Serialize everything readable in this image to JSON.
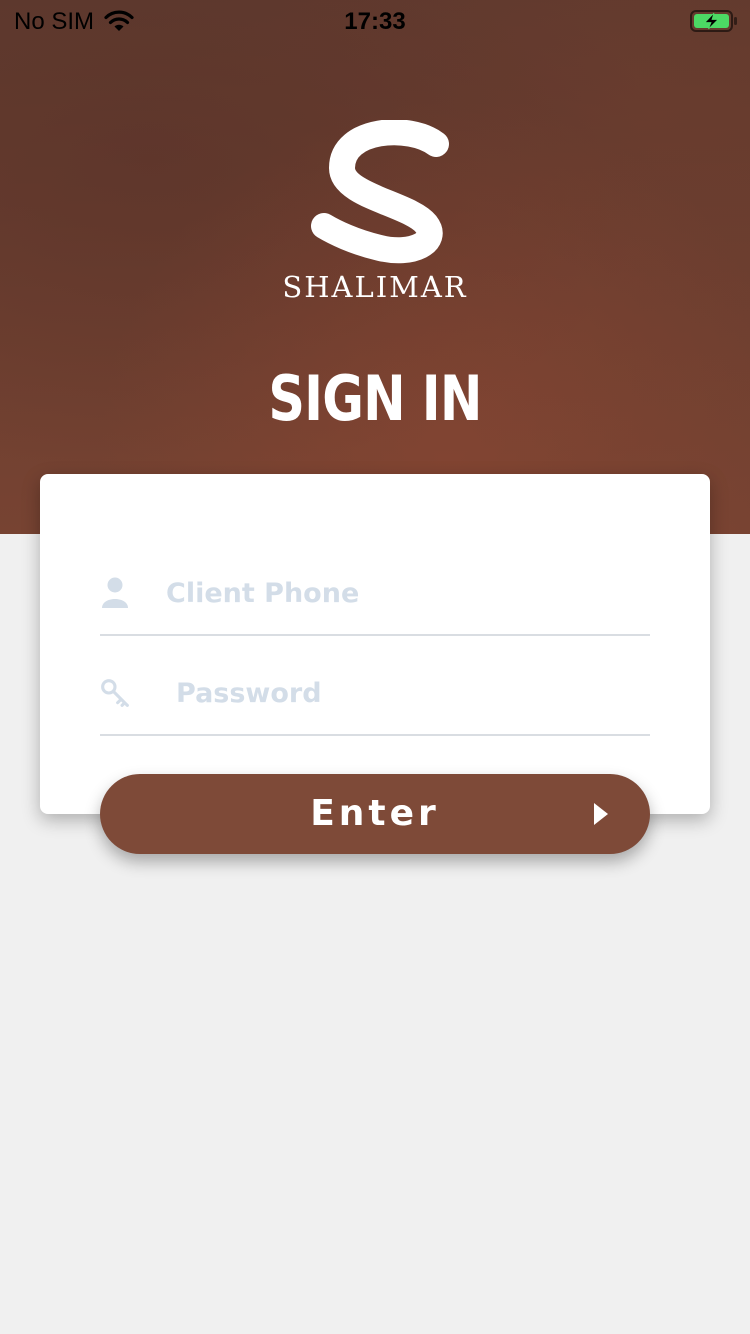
{
  "status_bar": {
    "carrier": "No SIM",
    "time": "17:33",
    "icons": [
      "wifi-icon",
      "battery-charging-icon"
    ]
  },
  "brand": {
    "logo_icon": "s-logo-icon",
    "name": "SHALIMAR"
  },
  "title": "SIGN IN",
  "form": {
    "phone": {
      "placeholder": "Client Phone",
      "value": "",
      "icon": "user-icon"
    },
    "password": {
      "placeholder": "Password",
      "value": "",
      "icon": "key-icon"
    }
  },
  "enter_button": {
    "label": "Enter",
    "icon": "chevron-right-icon"
  },
  "colors": {
    "brand_brown": "#7e4a38",
    "placeholder": "#d3dde8",
    "background": "#f0f0f0",
    "battery_green": "#4cd964"
  }
}
